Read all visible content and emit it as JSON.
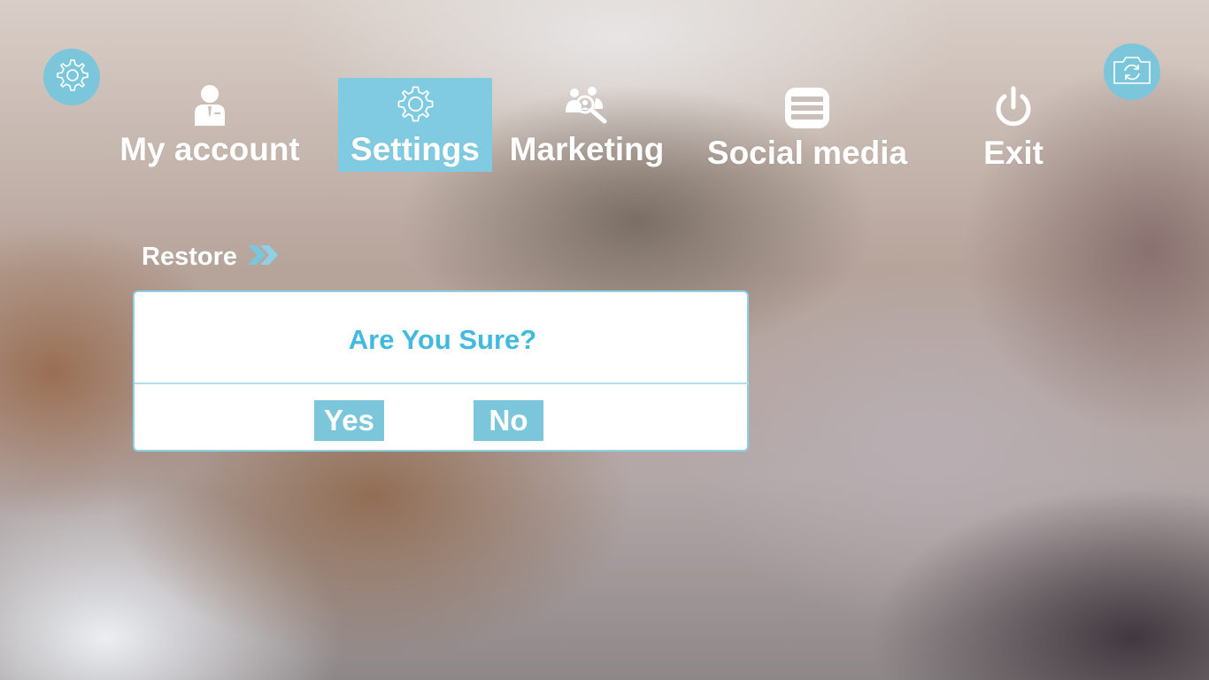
{
  "corner_buttons": {
    "left_icon": "gear-icon",
    "right_icon": "camera-refresh-icon"
  },
  "nav": {
    "items": [
      {
        "label": "My account",
        "icon": "user-icon",
        "active": false
      },
      {
        "label": "Settings",
        "icon": "gear-icon",
        "active": true
      },
      {
        "label": "Marketing",
        "icon": "team-search-icon",
        "active": false
      },
      {
        "label": "Social media",
        "icon": "list-icon",
        "active": false
      },
      {
        "label": "Exit",
        "icon": "power-icon",
        "active": false
      }
    ]
  },
  "breadcrumb": {
    "label": "Restore",
    "icon": "double-chevron-right-icon"
  },
  "dialog": {
    "title": "Are You Sure?",
    "yes_label": "Yes",
    "no_label": "No"
  },
  "colors": {
    "accent": "#7cc6dc",
    "active_tab": "#80cbe1",
    "dialog_title": "#43b9e0",
    "dialog_border": "#8fd0e4",
    "text_light": "#ffffff"
  }
}
